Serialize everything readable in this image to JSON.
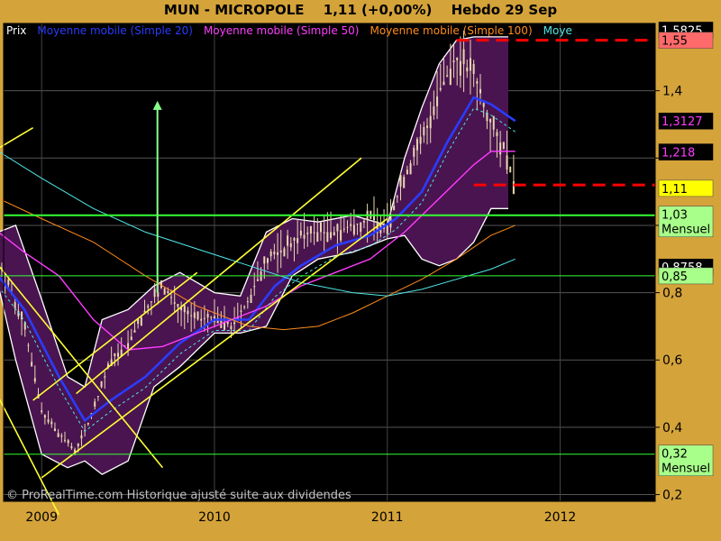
{
  "header": {
    "symbol": "MUN - MICROPOLE",
    "price": "1,11 (+0,00%)",
    "period": "Hebdo  29 Sep"
  },
  "legend": [
    {
      "text": "Prix",
      "color": "#ffffff"
    },
    {
      "text": "Moyenne mobile (Simple 20)",
      "color": "#2a3cff"
    },
    {
      "text": "Moyenne mobile (Simple 50)",
      "color": "#ff3cff"
    },
    {
      "text": "Moyenne mobile (Simple 100)",
      "color": "#ff8c1a"
    },
    {
      "text": "Moye",
      "color": "#4fe8e8"
    }
  ],
  "footer": {
    "watermark": "© ProRealTime.com Historique ajusté suite aux dividendes"
  },
  "colors": {
    "background": "#000000",
    "frame": "#d4a33a",
    "band": "#4a1450",
    "trend": "#ffff33",
    "support": "#33ff33",
    "resistance": "#ff0000"
  },
  "chart_data": {
    "type": "candlestick",
    "x_ticks": [
      "2009",
      "2010",
      "2011",
      "2012"
    ],
    "y_ticks": [
      0.2,
      0.4,
      0.6,
      0.8,
      1.0,
      1.2,
      1.4
    ],
    "y_tick_labels": [
      "0,2",
      "0,4",
      "0,6",
      "0,8",
      "",
      "",
      "1,4"
    ],
    "ylim": [
      0.18,
      1.6
    ],
    "series": [
      {
        "name": "Prix",
        "x": [
          2008.75,
          2008.9,
          2009.0,
          2009.1,
          2009.2,
          2009.3,
          2009.4,
          2009.5,
          2009.6,
          2009.7,
          2009.8,
          2009.9,
          2010.0,
          2010.1,
          2010.2,
          2010.3,
          2010.4,
          2010.5,
          2010.6,
          2010.7,
          2010.8,
          2010.9,
          2011.0,
          2011.1,
          2011.2,
          2011.3,
          2011.4,
          2011.5,
          2011.6,
          2011.7,
          2011.74
        ],
        "values": [
          0.9,
          0.7,
          0.45,
          0.38,
          0.33,
          0.45,
          0.6,
          0.65,
          0.75,
          0.82,
          0.75,
          0.72,
          0.73,
          0.7,
          0.78,
          0.9,
          0.93,
          0.97,
          0.98,
          0.98,
          1.0,
          1.02,
          1.0,
          1.15,
          1.25,
          1.4,
          1.5,
          1.45,
          1.3,
          1.2,
          1.11
        ]
      },
      {
        "name": "Moyenne mobile (Simple 20)",
        "x": [
          2008.75,
          2008.9,
          2009.1,
          2009.25,
          2009.4,
          2009.6,
          2009.8,
          2010.0,
          2010.2,
          2010.35,
          2010.5,
          2010.7,
          2010.9,
          2011.05,
          2011.2,
          2011.35,
          2011.5,
          2011.6,
          2011.74
        ],
        "values": [
          0.85,
          0.75,
          0.55,
          0.42,
          0.48,
          0.55,
          0.65,
          0.72,
          0.72,
          0.82,
          0.88,
          0.94,
          0.97,
          1.02,
          1.1,
          1.25,
          1.38,
          1.36,
          1.31
        ]
      },
      {
        "name": "Moyenne mobile (Simple 50)",
        "x": [
          2008.75,
          2008.9,
          2009.1,
          2009.3,
          2009.5,
          2009.7,
          2009.9,
          2010.1,
          2010.3,
          2010.5,
          2010.7,
          2010.9,
          2011.1,
          2011.3,
          2011.5,
          2011.6,
          2011.74
        ],
        "values": [
          0.98,
          0.92,
          0.85,
          0.72,
          0.63,
          0.64,
          0.68,
          0.72,
          0.76,
          0.82,
          0.86,
          0.9,
          0.98,
          1.08,
          1.18,
          1.22,
          1.22
        ]
      },
      {
        "name": "Moyenne mobile (Simple 100)",
        "x": [
          2008.75,
          2009.0,
          2009.3,
          2009.6,
          2009.9,
          2010.2,
          2010.4,
          2010.6,
          2010.8,
          2011.0,
          2011.2,
          2011.4,
          2011.6,
          2011.74
        ],
        "values": [
          1.08,
          1.02,
          0.95,
          0.85,
          0.76,
          0.7,
          0.69,
          0.7,
          0.74,
          0.79,
          0.84,
          0.9,
          0.97,
          1.0
        ]
      },
      {
        "name": "Moye",
        "x": [
          2008.75,
          2009.0,
          2009.3,
          2009.6,
          2009.9,
          2010.2,
          2010.5,
          2010.8,
          2011.0,
          2011.2,
          2011.4,
          2011.6,
          2011.74
        ],
        "values": [
          1.22,
          1.14,
          1.05,
          0.98,
          0.93,
          0.88,
          0.83,
          0.8,
          0.79,
          0.81,
          0.84,
          0.87,
          0.9
        ]
      }
    ],
    "bollinger_upper": {
      "x": [
        2008.75,
        2008.85,
        2009.0,
        2009.15,
        2009.25,
        2009.35,
        2009.5,
        2009.65,
        2009.8,
        2010.0,
        2010.15,
        2010.3,
        2010.45,
        2010.6,
        2010.8,
        2011.0,
        2011.1,
        2011.2,
        2011.3,
        2011.4,
        2011.5,
        2011.6,
        2011.7
      ],
      "values": [
        0.98,
        1.0,
        0.78,
        0.55,
        0.52,
        0.72,
        0.75,
        0.82,
        0.86,
        0.8,
        0.79,
        0.98,
        1.02,
        1.01,
        1.03,
        1.0,
        1.2,
        1.35,
        1.48,
        1.55,
        1.56,
        1.56,
        1.56
      ]
    },
    "bollinger_lower": {
      "x": [
        2008.75,
        2008.85,
        2009.0,
        2009.15,
        2009.25,
        2009.35,
        2009.5,
        2009.65,
        2009.8,
        2010.0,
        2010.15,
        2010.3,
        2010.45,
        2010.6,
        2010.8,
        2011.0,
        2011.1,
        2011.2,
        2011.3,
        2011.4,
        2011.5,
        2011.6,
        2011.7
      ],
      "values": [
        0.82,
        0.6,
        0.32,
        0.28,
        0.3,
        0.26,
        0.3,
        0.52,
        0.58,
        0.68,
        0.68,
        0.7,
        0.85,
        0.9,
        0.92,
        0.96,
        0.97,
        0.9,
        0.88,
        0.9,
        0.95,
        1.05,
        1.05
      ]
    },
    "right_labels": [
      {
        "text": "1,5825",
        "value": 1.58,
        "bg": "#000000",
        "fg": "#ffffff"
      },
      {
        "text": "1,55",
        "value": 1.55,
        "bg": "#ff6a6a",
        "fg": "#000000"
      },
      {
        "text": "1,3127",
        "value": 1.31,
        "bg": "#000000",
        "fg": "#ff3cff"
      },
      {
        "text": "1,218",
        "value": 1.218,
        "bg": "#000000",
        "fg": "#ff3cff"
      },
      {
        "text": "1,11",
        "value": 1.11,
        "bg": "#ffff00",
        "fg": "#000000"
      },
      {
        "text": "1,03",
        "sub": "Mensuel",
        "value": 1.03,
        "bg": "#a8ff8a",
        "fg": "#000000"
      },
      {
        "text": "0,8758",
        "value": 0.876,
        "bg": "#000000",
        "fg": "#ffffff"
      },
      {
        "text": "0,85",
        "value": 0.85,
        "bg": "#a8ff8a",
        "fg": "#000000"
      },
      {
        "text": "0,32",
        "sub": "Mensuel",
        "value": 0.32,
        "bg": "#a8ff8a",
        "fg": "#000000"
      }
    ],
    "horizontal_lines": [
      {
        "value": 1.55,
        "from": 2011.4,
        "style": "red-dash"
      },
      {
        "value": 1.12,
        "from": 2011.5,
        "style": "red-dash"
      },
      {
        "value": 1.03,
        "from": 2008.72,
        "style": "green"
      },
      {
        "value": 0.85,
        "from": 2008.72,
        "style": "green-thin"
      },
      {
        "value": 0.32,
        "from": 2008.78,
        "style": "green-thin"
      }
    ],
    "trend_lines": [
      {
        "x1": 2008.72,
        "y1": 1.22,
        "x2": 2008.95,
        "y2": 1.29
      },
      {
        "x1": 2008.72,
        "y1": 0.52,
        "x2": 2009.1,
        "y2": 0.14
      },
      {
        "x1": 2008.72,
        "y1": 0.9,
        "x2": 2009.7,
        "y2": 0.28
      },
      {
        "x1": 2008.95,
        "y1": 0.48,
        "x2": 2009.9,
        "y2": 0.86
      },
      {
        "x1": 2009.0,
        "y1": 0.25,
        "x2": 2011.0,
        "y2": 1.02
      },
      {
        "x1": 2009.2,
        "y1": 0.5,
        "x2": 2010.85,
        "y2": 1.2
      }
    ],
    "arrow": {
      "x": 2009.67,
      "y1": 0.8,
      "y2": 1.37
    }
  }
}
